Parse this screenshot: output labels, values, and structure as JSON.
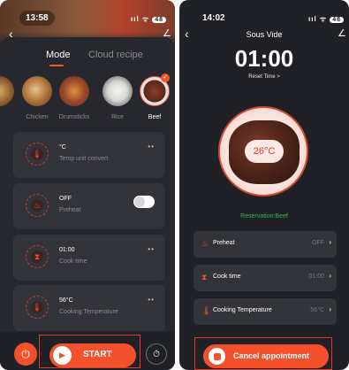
{
  "left": {
    "status_time": "13:58",
    "status_icons": "ııl ᯤ",
    "battery": "48",
    "tabs": [
      {
        "label": "Mode"
      },
      {
        "label": "Cloud recipe"
      }
    ],
    "foods": [
      {
        "label": "Chicken"
      },
      {
        "label": "Drumsticks"
      },
      {
        "label": "Rice"
      },
      {
        "label": "Beef"
      }
    ],
    "cards": [
      {
        "value": "°C",
        "sub": "Temp unit convert",
        "action": "••"
      },
      {
        "value": "OFF",
        "sub": "Preheat"
      },
      {
        "value": "01:00",
        "sub": "Cook time",
        "action": "••"
      },
      {
        "value": "56°C",
        "sub": "Cooking Temperature",
        "action": "••"
      }
    ],
    "start_label": "START"
  },
  "right": {
    "status_time": "14:02",
    "status_icons": "ııl ᯤ",
    "battery": "48",
    "title": "Sous Vide",
    "countdown": "01:00",
    "reset": "Reset Time >",
    "dial_temp": "26°C",
    "reservation": "Reservation:Beef",
    "rows": [
      {
        "label": "Preheat",
        "value": "OFF"
      },
      {
        "label": "Cook time",
        "value": "01:00"
      },
      {
        "label": "Cooking Temperature",
        "value": "56°C"
      }
    ],
    "cancel_label": "Cancel appointment"
  },
  "colors": {
    "accent": "#f2512b",
    "panel_bg": "#202126",
    "card_bg": "#33343a",
    "highlight": "#e0392a",
    "reservation": "#32b55a"
  }
}
